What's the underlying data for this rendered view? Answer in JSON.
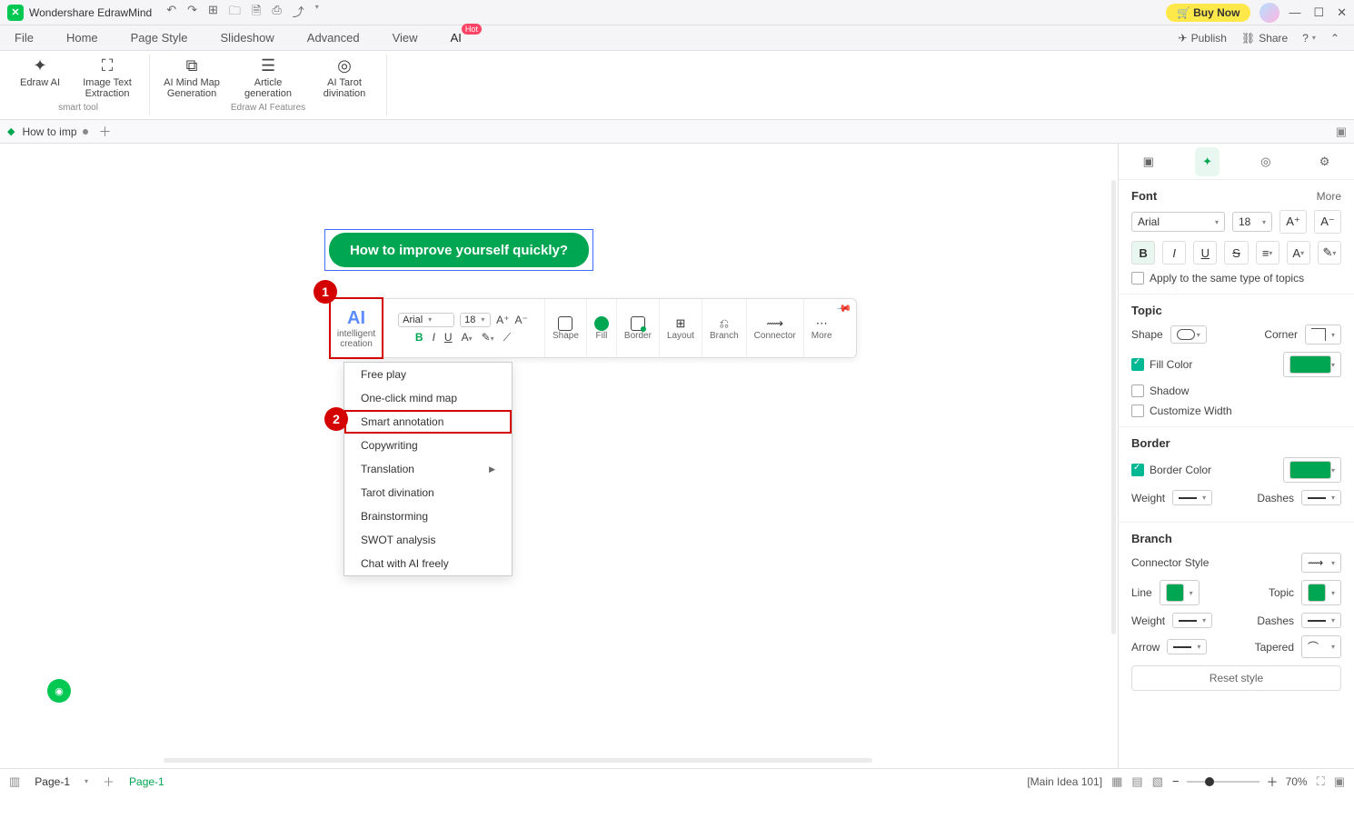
{
  "app": {
    "title": "Wondershare EdrawMind",
    "buy": "Buy Now"
  },
  "menu": {
    "items": [
      "File",
      "Home",
      "Page Style",
      "Slideshow",
      "Advanced",
      "View"
    ],
    "ai": "AI",
    "hot": "Hot",
    "publish": "Publish",
    "share": "Share"
  },
  "ribbon": {
    "group1": {
      "btn1": "Edraw AI",
      "btn2": "Image Text Extraction",
      "label": "smart tool"
    },
    "group2": {
      "btn1": "AI Mind Map Generation",
      "btn2": "Article generation",
      "btn3": "AI Tarot divination",
      "label": "Edraw AI Features"
    }
  },
  "tab": {
    "name": "How to imp"
  },
  "node": {
    "text": "How to improve yourself quickly?"
  },
  "badge1": "1",
  "badge2": "2",
  "ftb": {
    "ai": "AI",
    "ai_label": "intelligent creation",
    "font": "Arial",
    "size": "18",
    "shape": "Shape",
    "fill": "Fill",
    "border": "Border",
    "layout": "Layout",
    "branch": "Branch",
    "connector": "Connector",
    "more": "More"
  },
  "dropdown": {
    "items": [
      "Free play",
      "One-click mind map",
      "Smart annotation",
      "Copywriting",
      "Translation",
      "Tarot divination",
      "Brainstorming",
      "SWOT analysis",
      "Chat with AI freely"
    ]
  },
  "panel": {
    "font": {
      "title": "Font",
      "more": "More",
      "family": "Arial",
      "size": "18",
      "apply": "Apply to the same type of topics"
    },
    "topic": {
      "title": "Topic",
      "shape": "Shape",
      "corner": "Corner",
      "fill": "Fill Color",
      "shadow": "Shadow",
      "custom": "Customize Width"
    },
    "border": {
      "title": "Border",
      "color": "Border Color",
      "weight": "Weight",
      "dashes": "Dashes"
    },
    "branch": {
      "title": "Branch",
      "connstyle": "Connector Style",
      "line": "Line",
      "topic": "Topic",
      "weight": "Weight",
      "dashes": "Dashes",
      "arrow": "Arrow",
      "tapered": "Tapered"
    },
    "reset": "Reset style"
  },
  "status": {
    "page": "Page-1",
    "page_tab": "Page-1",
    "info": "[Main Idea 101]",
    "zoom": "70%"
  }
}
